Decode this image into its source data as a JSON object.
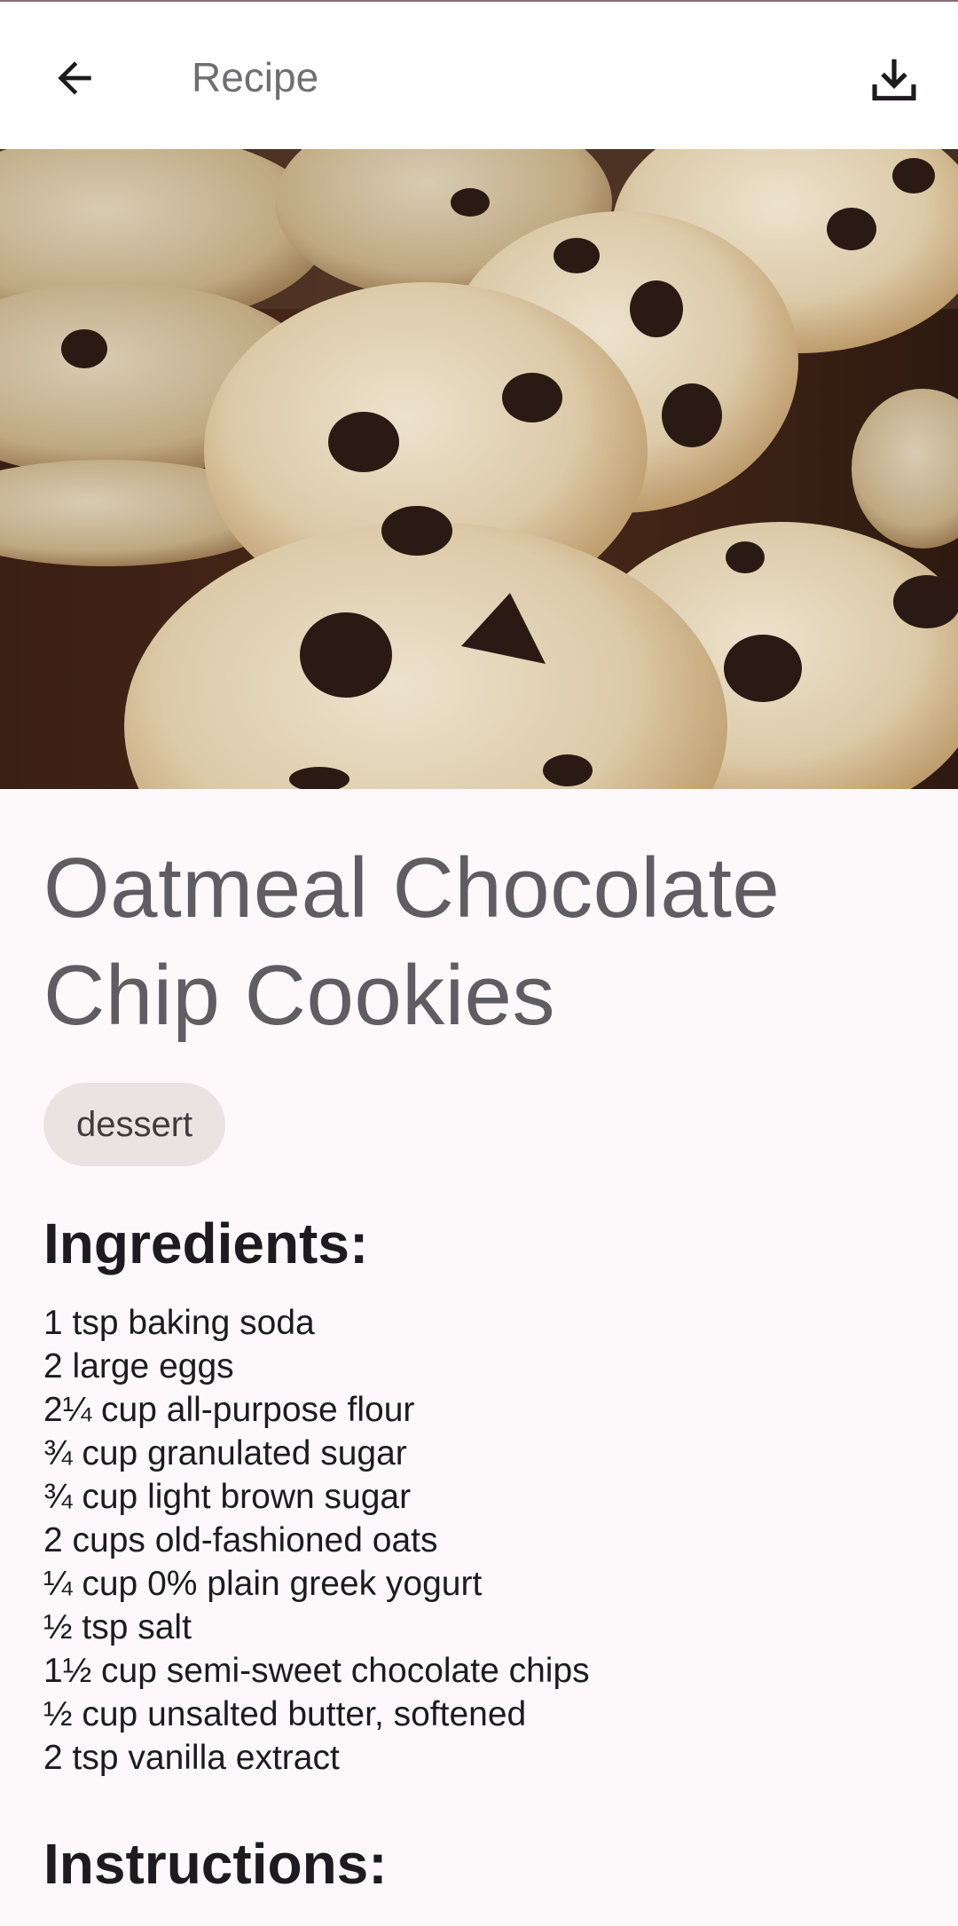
{
  "app_bar": {
    "title": "Recipe",
    "back_icon": "arrow-left-icon",
    "download_icon": "download-icon"
  },
  "hero": {
    "image": "oatmeal-chocolate-chip-cookies-photo"
  },
  "recipe": {
    "title": "Oatmeal Chocolate Chip Cookies",
    "tag": "dessert",
    "ingredients_heading": "Ingredients:",
    "ingredients": [
      "1 tsp baking soda",
      "2 large eggs",
      "2¼ cup all-purpose flour",
      "¾ cup granulated sugar",
      "¾ cup light brown sugar",
      "2 cups old-fashioned oats",
      "¼ cup 0% plain greek yogurt",
      "½ tsp salt",
      "1½ cup semi-sweet chocolate chips",
      "½ cup unsalted butter, softened",
      "2 tsp vanilla extract"
    ],
    "instructions_heading": "Instructions:"
  },
  "colors": {
    "background": "#fdf9fb",
    "title_text": "#5f5d61",
    "chip_background": "#e9e3e2",
    "body_text": "#1d1b1e"
  }
}
